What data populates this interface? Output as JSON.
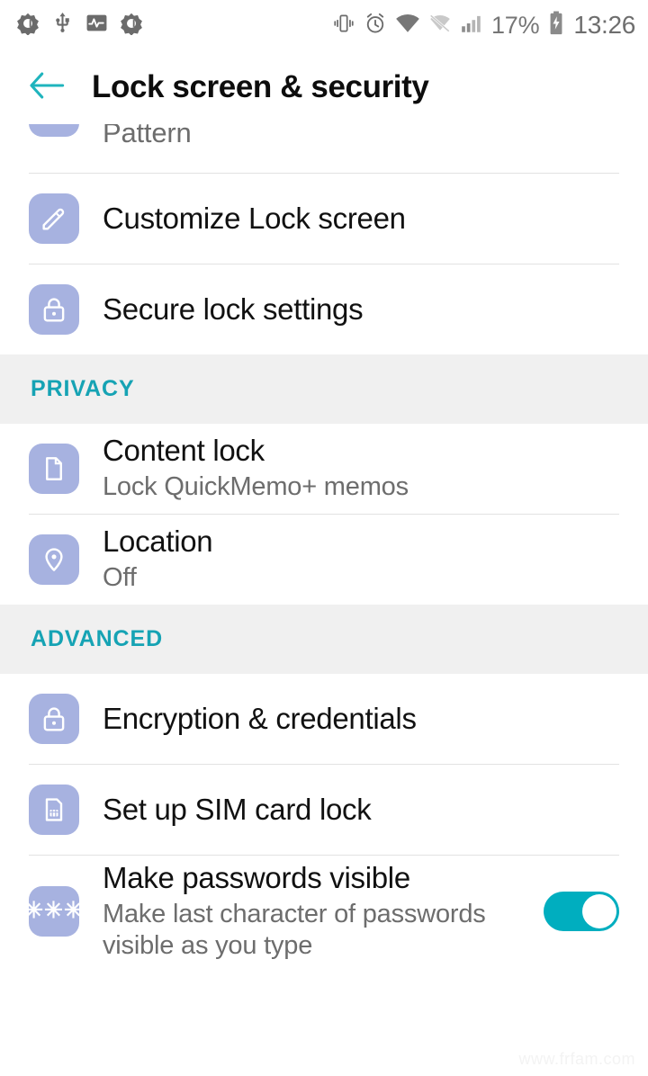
{
  "statusbar": {
    "left_icons": [
      "antivirus-shield-icon",
      "usb-icon",
      "activity-monitor-icon",
      "antivirus-shield-icon"
    ],
    "right_icons": [
      "vibrate-icon",
      "alarm-icon",
      "wifi-icon",
      "mobile-data-off-icon",
      "signal-bars-icon"
    ],
    "battery_percent": "17%",
    "battery_state": "charging",
    "clock": "13:26"
  },
  "appbar": {
    "back_label": "back-arrow",
    "title": "Lock screen & security"
  },
  "colors": {
    "accent_teal": "#16a3b4",
    "toggle_on": "#00aebf",
    "icon_tile": "#a7b2e0",
    "section_band": "#f0f0f0",
    "divider": "#e2e2e2"
  },
  "list": {
    "cut_row": {
      "label": "Pattern",
      "icon": "pattern-lock-icon"
    },
    "items": [
      {
        "title": "Customize Lock screen",
        "subtitle": "",
        "icon": "pencil-icon",
        "toggle": null
      },
      {
        "title": "Secure lock settings",
        "subtitle": "",
        "icon": "padlock-icon",
        "toggle": null
      }
    ]
  },
  "sections": [
    {
      "label": "PRIVACY",
      "items": [
        {
          "title": "Content lock",
          "subtitle": "Lock QuickMemo+ memos",
          "icon": "document-icon",
          "toggle": null
        },
        {
          "title": "Location",
          "subtitle": "Off",
          "icon": "map-pin-icon",
          "toggle": null
        }
      ]
    },
    {
      "label": "ADVANCED",
      "items": [
        {
          "title": "Encryption & credentials",
          "subtitle": "",
          "icon": "padlock-icon",
          "toggle": null
        },
        {
          "title": "Set up SIM card lock",
          "subtitle": "",
          "icon": "sim-card-icon",
          "toggle": null
        },
        {
          "title": "Make passwords visible",
          "subtitle": "Make last character of passwords visible as you type",
          "icon": "asterisks-icon",
          "icon_glyph": "✳✳✳",
          "toggle": "on"
        }
      ]
    }
  ],
  "watermark": "www.frfam.com"
}
